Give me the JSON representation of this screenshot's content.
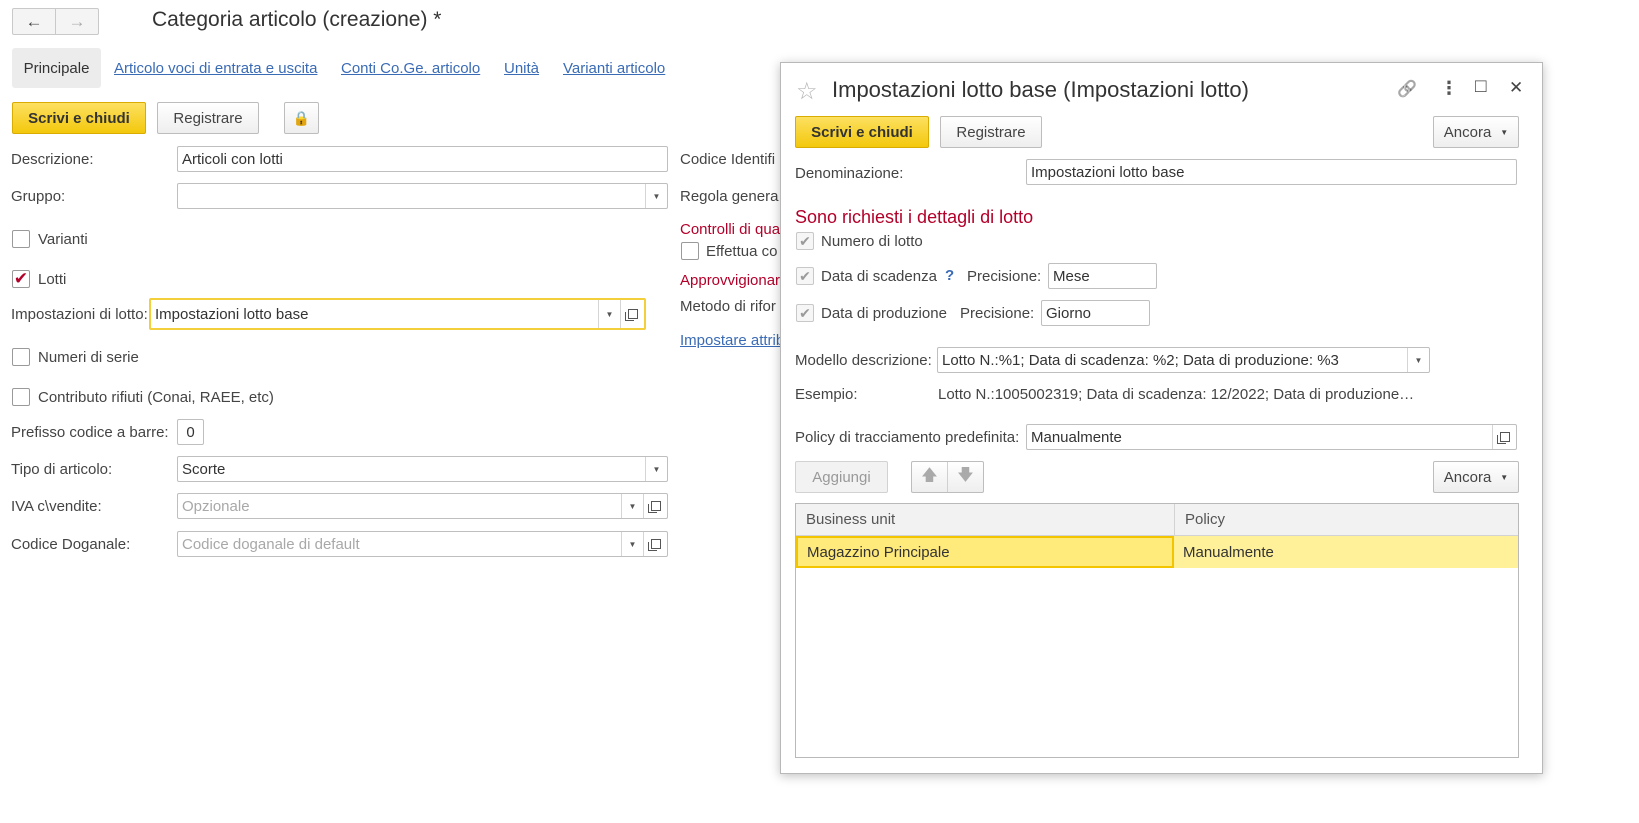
{
  "header": {
    "back_icon": "←",
    "forward_icon": "→",
    "title": "Categoria articolo (creazione) *"
  },
  "tabs": {
    "principale": "Principale",
    "voci": "Articolo voci di entrata e uscita",
    "conti": "Conti Co.Ge. articolo",
    "unita": "Unità",
    "varianti": "Varianti articolo"
  },
  "toolbar": {
    "save_close": "Scrivi e chiudi",
    "register": "Registrare",
    "lock_icon": "🔒"
  },
  "form": {
    "descrizione_label": "Descrizione:",
    "descrizione_value": "Articoli con lotti",
    "gruppo_label": "Gruppo:",
    "gruppo_value": "",
    "varianti_label": "Varianti",
    "lotti_label": "Lotti",
    "lotti_check": "✔",
    "impostazioni_label": "Impostazioni di lotto:",
    "impostazioni_value": "Impostazioni lotto base",
    "numeri_serie_label": "Numeri di serie",
    "contributo_label": "Contributo rifiuti (Conai, RAEE, etc)",
    "prefisso_label": "Prefisso codice a barre:",
    "prefisso_value": "0",
    "tipo_label": "Tipo di articolo:",
    "tipo_value": "Scorte",
    "iva_label": "IVA c\\vendite:",
    "iva_placeholder": "Opzionale",
    "doganale_label": "Codice Doganale:",
    "doganale_placeholder": "Codice doganale di default",
    "dropdown_icon": "▼"
  },
  "right_column": {
    "codice": "Codice Identifi",
    "regola": "Regola genera",
    "controlli": "Controlli di qua",
    "effettua": "Effettua co",
    "approvvigionamento": "Approvvigionar",
    "metodo": "Metodo di rifor",
    "impostare": "Impostare attrib"
  },
  "dialog": {
    "star_icon": "☆",
    "title": "Impostazioni lotto base (Impostazioni lotto)",
    "link_icon": "🔗",
    "more_icon": "⋮",
    "maximize_icon": "□",
    "close_icon": "✕",
    "save_close": "Scrivi e chiudi",
    "register": "Registrare",
    "ancora": "Ancora",
    "denominazione_label": "Denominazione:",
    "denominazione_value": "Impostazioni lotto base",
    "section_title": "Sono richiesti i dettagli di lotto",
    "check_mark": "✔",
    "numero_lotto": "Numero di lotto",
    "data_scadenza": "Data di scadenza",
    "help_icon": "?",
    "precisione_label": "Precisione:",
    "precisione_scadenza": "Mese",
    "data_produzione": "Data di produzione",
    "precisione_produzione": "Giorno",
    "modello_label": "Modello descrizione:",
    "modello_value": "Lotto N.:%1; Data di scadenza: %2; Data di produzione: %3",
    "esempio_label": "Esempio:",
    "esempio_value": "Lotto N.:1005002319; Data di scadenza: 12/2022; Data di produzione…",
    "policy_label": "Policy di tracciamento predefinita:",
    "policy_value": "Manualmente",
    "aggiungi": "Aggiungi",
    "up_icon": "🡅",
    "down_icon": "🡇",
    "ancora2": "Ancora",
    "table": {
      "col_business": "Business unit",
      "col_policy": "Policy",
      "rows": [
        {
          "business": "Magazzino Principale",
          "policy": "Manualmente"
        }
      ]
    }
  }
}
